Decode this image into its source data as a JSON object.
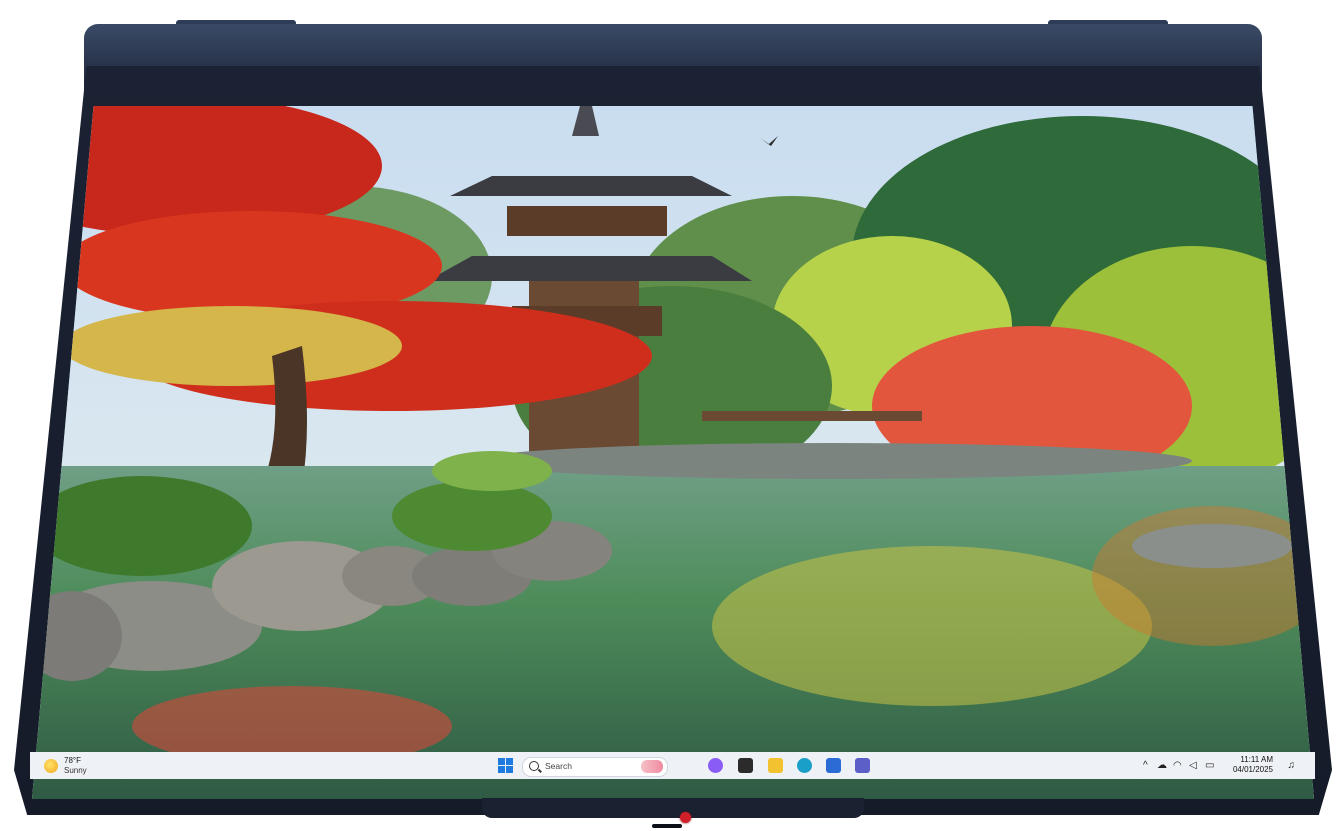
{
  "weather": {
    "temperature": "78°F",
    "condition": "Sunny",
    "icon": "sun-icon"
  },
  "search": {
    "placeholder": "Search"
  },
  "taskbar_apps": [
    {
      "name": "copilot-icon",
      "color": "#8a5cf6"
    },
    {
      "name": "task-view-icon",
      "color": "#2b2b2b"
    },
    {
      "name": "file-explorer-icon",
      "color": "#f2c230"
    },
    {
      "name": "edge-icon",
      "color": "#1aa0c8"
    },
    {
      "name": "store-icon",
      "color": "#2b6bd6"
    },
    {
      "name": "teams-icon",
      "color": "#5b5fc7"
    }
  ],
  "tray": {
    "chevron": "^",
    "time": "11:11 AM",
    "date": "04/01/2025"
  },
  "colors": {
    "accent": "#1f7ae0",
    "bezel": "#151b29",
    "camera": "#d2202a"
  }
}
